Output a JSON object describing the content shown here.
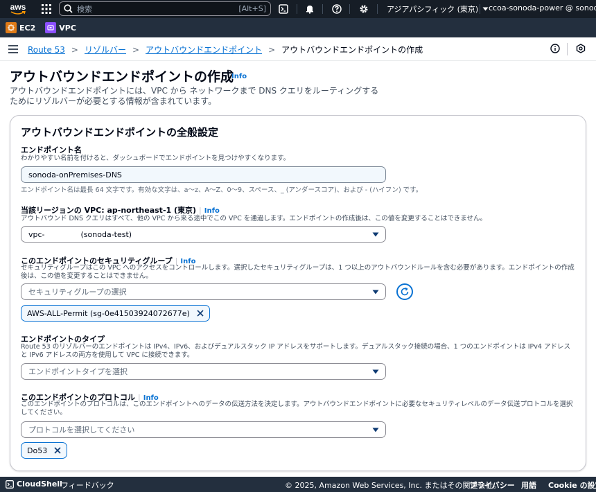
{
  "topnav": {
    "logo_text": "aws",
    "search_placeholder": "検索",
    "search_shortcut": "[Alt+S]",
    "region": "アジアパシフィック (東京)",
    "account": "ccoa-sonoda-power @ sonoda"
  },
  "favorites": [
    {
      "label": "EC2",
      "color": "#e07b17"
    },
    {
      "label": "VPC",
      "color": "#8c4fff"
    }
  ],
  "breadcrumb": {
    "items": [
      "Route 53",
      "リゾルバー",
      "アウトバウンドエンドポイント"
    ],
    "current": "アウトバウンドエンドポイントの作成"
  },
  "header": {
    "title": "アウトバウンドエンドポイントの作成",
    "info": "Info",
    "description": "アウトバウンドエンドポイントには、VPC から ネットワークまで DNS クエリをルーティングするためにリゾルバーが必要とする情報が含まれています。"
  },
  "panel": {
    "title": "アウトバウンドエンドポイントの全般設定",
    "endpoint_name": {
      "label": "エンドポイント名",
      "description": "わかりやすい名前を付けると、ダッシュボードでエンドポイントを見つけやすくなります。",
      "value": "sonoda-onPremises-DNS",
      "hint": "エンドポイント名は最長 64 文字です。有効な文字は、a～z、A～Z、0～9、スペース、_ (アンダースコア)、および - (ハイフン) です。"
    },
    "vpc": {
      "label": "当該リージョンの VPC: ap-northeast-1 (東京)",
      "info": "Info",
      "description": "アウトバウンド DNS クエリはすべて、他の VPC から来る途中でこの VPC を通過します。エンドポイントの作成後は、この値を変更することはできません。",
      "value_prefix": "vpc-",
      "value_suffix": "(sonoda-test)"
    },
    "security_group": {
      "label": "このエンドポイントのセキュリティグループ",
      "info": "Info",
      "description": "セキュリティグループはこの VPC へのアクセスをコントロールします。選択したセキュリティグループは、1 つ以上のアウトバウンドルールを含む必要があります。エンドポイントの作成後は、この値を変更することはできません。",
      "placeholder": "セキュリティグループの選択",
      "token": "AWS-ALL-Permit (sg-0e41503924072677e)"
    },
    "endpoint_type": {
      "label": "エンドポイントのタイプ",
      "description": "Route 53 のリゾルバーのエンドポイントは IPv4、IPv6、およびデュアルスタック IP アドレスをサポートします。デュアルスタック接続の場合、1 つのエンドポイントは IPv4 アドレスと IPv6 アドレスの両方を使用して VPC に接続できます。",
      "placeholder": "エンドポイントタイプを選択"
    },
    "protocol": {
      "label": "このエンドポイントのプロトコル",
      "info": "Info",
      "description": "このエンドポイントのプロトコルは、このエンドポイントへのデータの伝送方法を決定します。アウトバウンドエンドポイントに必要なセキュリティレベルのデータ伝送プロトコルを選択してください。",
      "placeholder": "プロトコルを選択してください",
      "token": "Do53"
    }
  },
  "footer": {
    "cloudshell": "CloudShell",
    "feedback": "フィードバック",
    "copyright": "© 2025, Amazon Web Services, Inc. またはその関連会社。",
    "privacy": "プライバシー",
    "terms": "用語",
    "cookie": "Cookie の設定"
  }
}
